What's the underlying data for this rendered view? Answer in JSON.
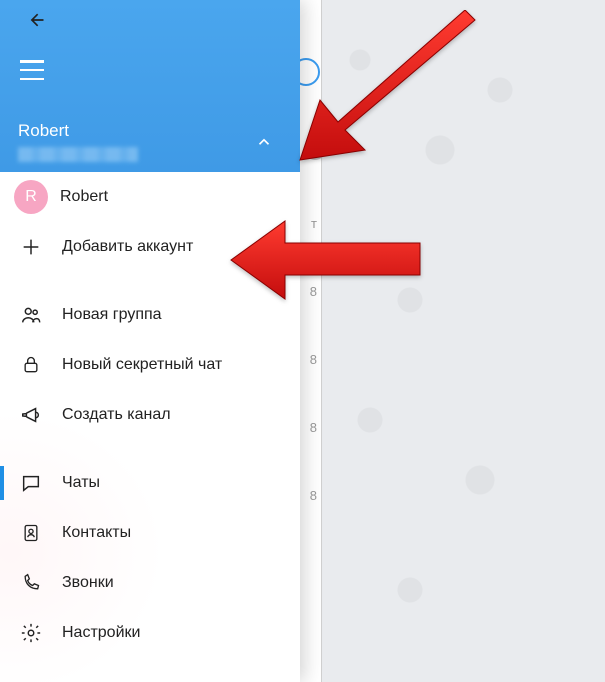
{
  "header": {
    "profile_name": "Robert"
  },
  "accounts": {
    "current": {
      "initial": "R",
      "name": "Robert"
    },
    "add_label": "Добавить аккаунт"
  },
  "menu": {
    "new_group": "Новая группа",
    "new_secret_chat": "Новый секретный чат",
    "create_channel": "Создать канал",
    "chats": "Чаты",
    "contacts": "Контакты",
    "calls": "Звонки",
    "settings": "Настройки"
  },
  "peek": {
    "r1": "т",
    "r2": "8",
    "r3": "8",
    "r4": "8",
    "r5": "8"
  },
  "colors": {
    "accent": "#3f9ae6",
    "arrow": "#e11b1b"
  }
}
